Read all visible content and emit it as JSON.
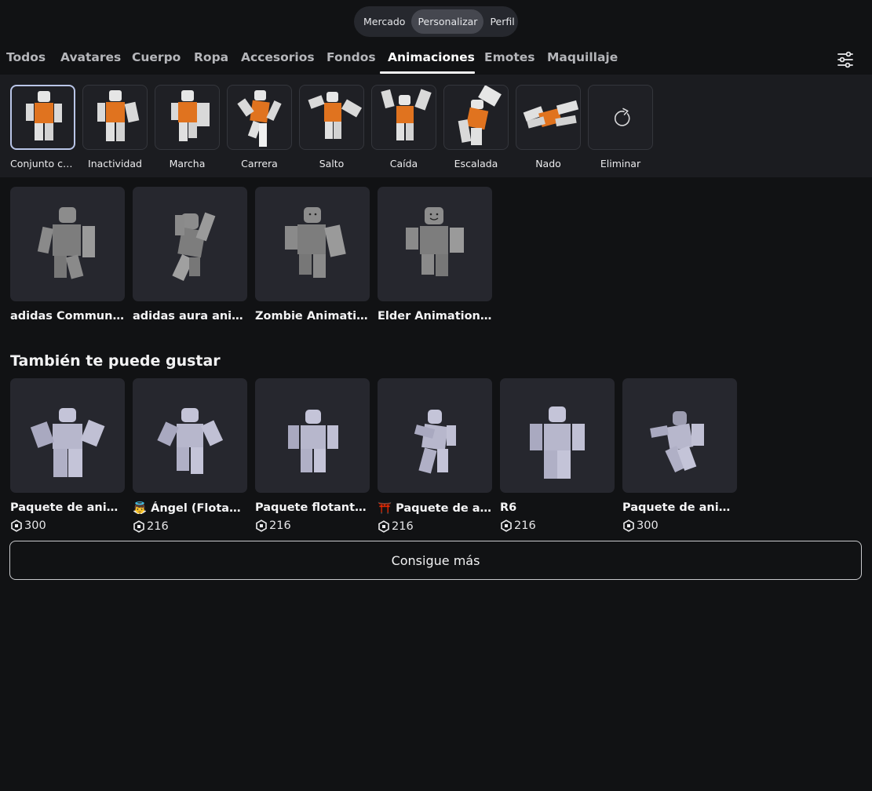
{
  "top_nav": {
    "items": [
      "Mercado",
      "Personalizar",
      "Perfil"
    ],
    "active_index": 1
  },
  "categories": {
    "items": [
      "Todos",
      "Avatares",
      "Cuerpo",
      "Ropa",
      "Accesorios",
      "Fondos",
      "Animaciones",
      "Emotes",
      "Maquillaje"
    ],
    "active": "Animaciones",
    "filter_icon": "sliders-icon"
  },
  "animation_slots": [
    {
      "label": "Conjunto co...",
      "selected": true
    },
    {
      "label": "Inactividad"
    },
    {
      "label": "Marcha"
    },
    {
      "label": "Carrera"
    },
    {
      "label": "Salto"
    },
    {
      "label": "Caída"
    },
    {
      "label": "Escalada"
    },
    {
      "label": "Nado"
    },
    {
      "label": "Eliminar",
      "icon": "reset-icon"
    }
  ],
  "owned_items": [
    {
      "name": "adidas Community"
    },
    {
      "name": "adidas aura anima..."
    },
    {
      "name": "Zombie Animation ..."
    },
    {
      "name": "Elder Animation P..."
    }
  ],
  "recommendations": {
    "title": "También te puede gustar",
    "currency_icon": "robux-icon",
    "items": [
      {
        "name": "Paquete de anima...",
        "price": "300"
      },
      {
        "name": "👼 Ángel (Flotante)",
        "price": "216"
      },
      {
        "name": "Paquete flotante ...",
        "price": "216"
      },
      {
        "name": "⛩️ Paquete de ani...",
        "price": "216"
      },
      {
        "name": "R6",
        "price": "216"
      },
      {
        "name": "Paquete de anima...",
        "price": "300"
      }
    ]
  },
  "more_button": "Consigue más",
  "colors": {
    "background": "#111214",
    "card": "#26272e",
    "slot_bar": "#1b1c20",
    "accent_orange": "#e0731f",
    "selected_border": "#b9c5e8"
  }
}
